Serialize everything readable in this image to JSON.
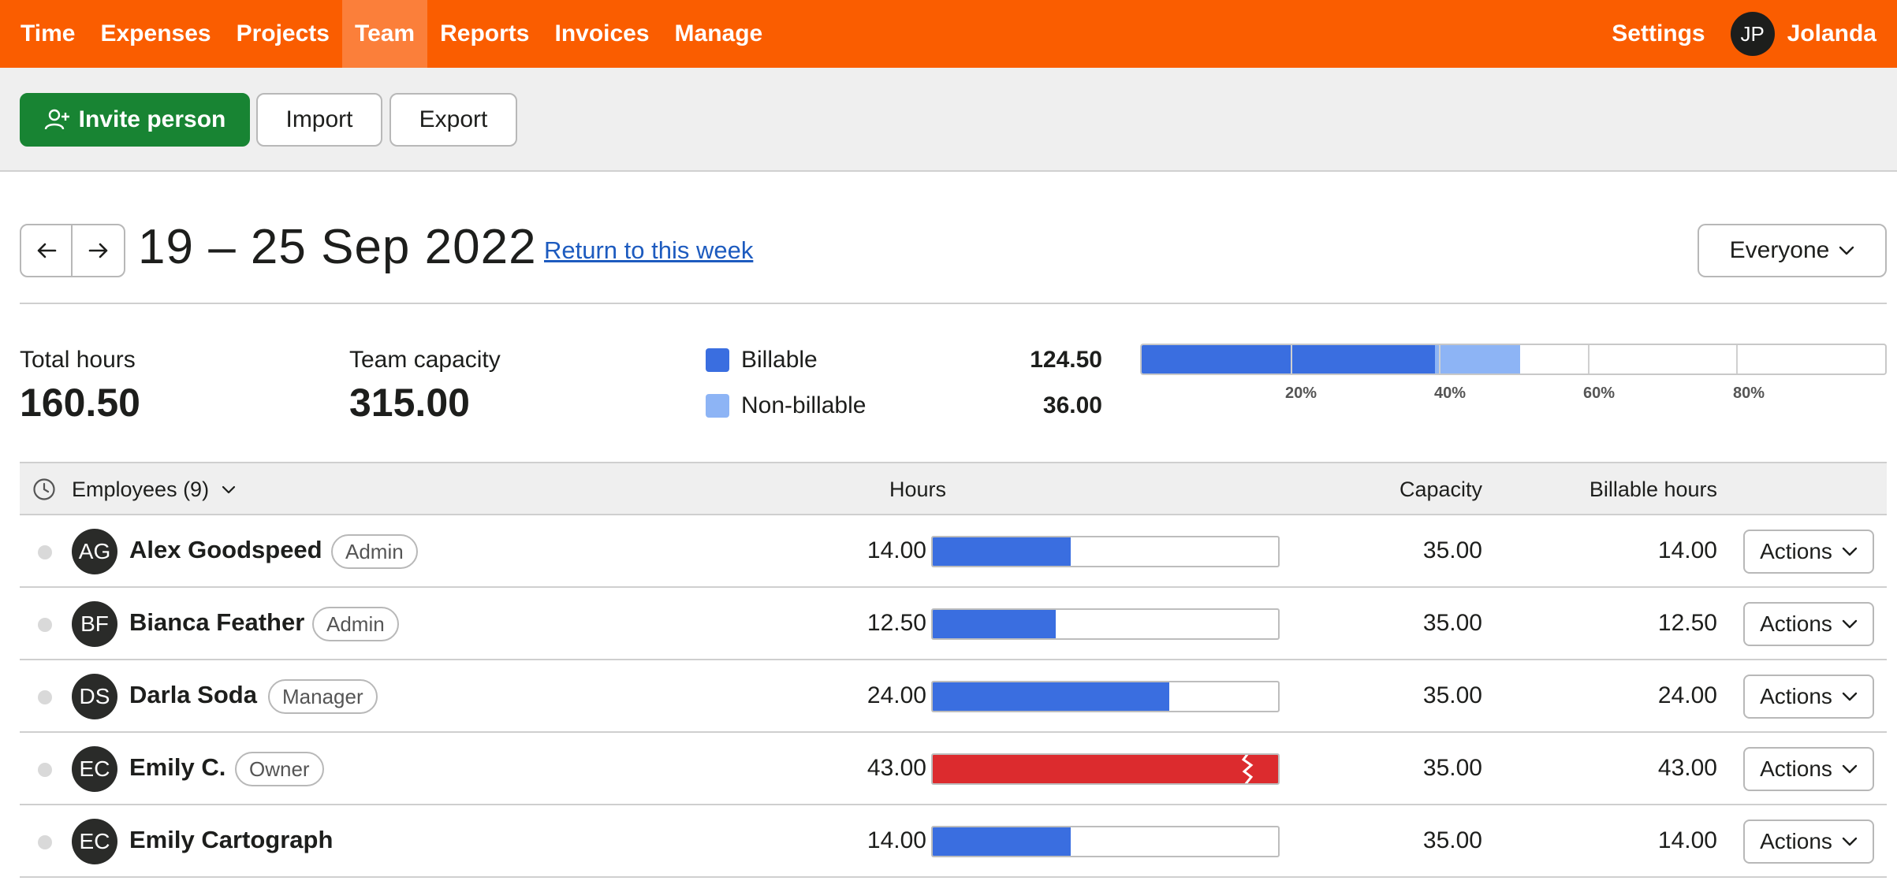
{
  "nav": {
    "items": [
      {
        "label": "Time",
        "active": false
      },
      {
        "label": "Expenses",
        "active": false
      },
      {
        "label": "Projects",
        "active": false
      },
      {
        "label": "Team",
        "active": true
      },
      {
        "label": "Reports",
        "active": false
      },
      {
        "label": "Invoices",
        "active": false
      },
      {
        "label": "Manage",
        "active": false
      }
    ],
    "settings_label": "Settings",
    "user_initials": "JP",
    "user_name": "Jolanda"
  },
  "toolbar": {
    "invite_label": "Invite person",
    "import_label": "Import",
    "export_label": "Export"
  },
  "week": {
    "title": "19 – 25 Sep 2022",
    "return_link": "Return to this week",
    "filter_label": "Everyone"
  },
  "summary": {
    "total_hours_label": "Total hours",
    "total_hours_value": "160.50",
    "team_capacity_label": "Team capacity",
    "team_capacity_value": "315.00",
    "billable_label": "Billable",
    "billable_value": "124.50",
    "nonbillable_label": "Non-billable",
    "nonbillable_value": "36.00",
    "billable_fraction": 0.395,
    "nonbillable_fraction": 0.114,
    "axis_labels": [
      "20%",
      "40%",
      "60%",
      "80%"
    ]
  },
  "colors": {
    "brand": "#fa5d00",
    "billable": "#3a6ee0",
    "nonbillable": "#8db4f5",
    "over_capacity": "#dc2b2e",
    "invite_green": "#188433"
  },
  "table": {
    "group_label": "Employees (9)",
    "headers": {
      "hours": "Hours",
      "capacity": "Capacity",
      "billable_hours": "Billable hours"
    },
    "rows": [
      {
        "initials": "AG",
        "name": "Alex Goodspeed",
        "role": "Admin",
        "hours": "14.00",
        "capacity": "35.00",
        "billable": "14.00",
        "usage_fraction": 0.4,
        "over": false,
        "actions": "Actions"
      },
      {
        "initials": "BF",
        "name": "Bianca Feather",
        "role": "Admin",
        "hours": "12.50",
        "capacity": "35.00",
        "billable": "12.50",
        "usage_fraction": 0.357,
        "over": false,
        "actions": "Actions"
      },
      {
        "initials": "DS",
        "name": "Darla Soda",
        "role": "Manager",
        "hours": "24.00",
        "capacity": "35.00",
        "billable": "24.00",
        "usage_fraction": 0.686,
        "over": false,
        "actions": "Actions"
      },
      {
        "initials": "EC",
        "name": "Emily C.",
        "role": "Owner",
        "hours": "43.00",
        "capacity": "35.00",
        "billable": "43.00",
        "usage_fraction": 1.0,
        "over": true,
        "actions": "Actions"
      },
      {
        "initials": "EC",
        "name": "Emily Cartograph",
        "role": "",
        "hours": "14.00",
        "capacity": "35.00",
        "billable": "14.00",
        "usage_fraction": 0.4,
        "over": false,
        "actions": "Actions"
      }
    ]
  }
}
